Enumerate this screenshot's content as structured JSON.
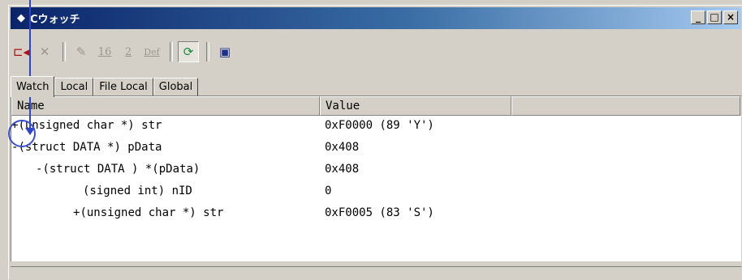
{
  "window": {
    "title": "Cウォッチ",
    "icon": "watch-window-icon",
    "controls": [
      "_",
      "□",
      "×"
    ]
  },
  "toolbar": {
    "items": [
      {
        "name": "watch-add-icon",
        "glyph": "▭◂",
        "enabled": true
      },
      {
        "name": "delete-icon",
        "glyph": "✕",
        "enabled": false
      },
      {
        "name": "edit-value-icon",
        "glyph": "✎",
        "enabled": false
      },
      {
        "name": "hex-radix-button",
        "label": "16",
        "enabled": false
      },
      {
        "name": "binary-radix-button",
        "label": "2",
        "enabled": false
      },
      {
        "name": "default-radix-button",
        "label": "Def",
        "enabled": false
      },
      {
        "name": "refresh-icon",
        "glyph": "⟳",
        "enabled": true
      },
      {
        "name": "monitor-icon",
        "glyph": "▣",
        "enabled": true
      }
    ]
  },
  "tabs": [
    "Watch",
    "Local",
    "File Local",
    "Global"
  ],
  "active_tab": "Watch",
  "columns": {
    "name": "Name",
    "value": "Value",
    "extra": ""
  },
  "rows": [
    {
      "expander": "+",
      "name": "(unsigned char *) str",
      "value": "0xF0000 (89 'Y')"
    },
    {
      "expander": "-",
      "name": "(struct DATA *) pData",
      "value": "0x408"
    },
    {
      "expander": "-",
      "name": "(struct DATA ) *(pData)",
      "value": "0x408"
    },
    {
      "expander": "",
      "name": "(signed int) nID",
      "value": "0"
    },
    {
      "expander": "+",
      "name": "(unsigned char *) str",
      "value": "0xF0005 (83 'S')"
    }
  ],
  "colors": {
    "titlebar_start": "#0a246a",
    "annotation": "#2f45c8"
  }
}
